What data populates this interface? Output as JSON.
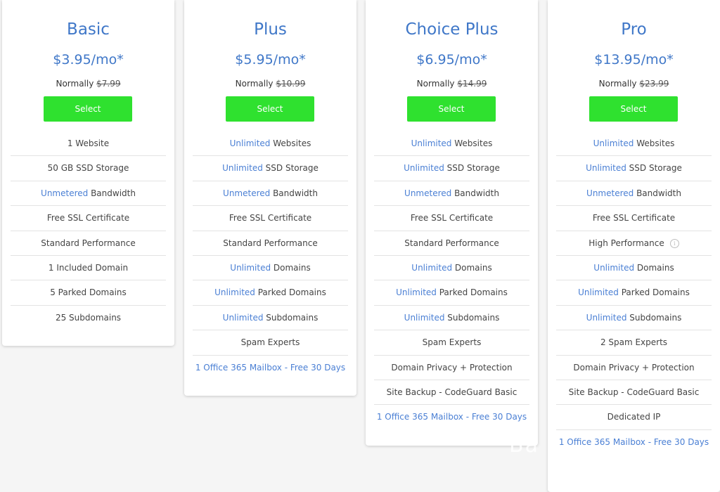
{
  "plans": [
    {
      "title": "Basic",
      "price": "$3.95/mo*",
      "normally_label": "Normally",
      "normally_price": "$7.99",
      "select_label": "Select",
      "features": [
        {
          "highlight": "",
          "text": "1 Website"
        },
        {
          "highlight": "",
          "text": "50 GB SSD Storage"
        },
        {
          "highlight": "Unmetered",
          "text": " Bandwidth"
        },
        {
          "highlight": "",
          "text": "Free SSL Certificate"
        },
        {
          "highlight": "",
          "text": "Standard Performance"
        },
        {
          "highlight": "",
          "text": "1 Included Domain"
        },
        {
          "highlight": "",
          "text": "5 Parked Domains"
        },
        {
          "highlight": "",
          "text": "25 Subdomains"
        }
      ]
    },
    {
      "title": "Plus",
      "price": "$5.95/mo*",
      "normally_label": "Normally",
      "normally_price": "$10.99",
      "select_label": "Select",
      "features": [
        {
          "highlight": "Unlimited",
          "text": " Websites"
        },
        {
          "highlight": "Unlimited",
          "text": " SSD Storage"
        },
        {
          "highlight": "Unmetered",
          "text": " Bandwidth"
        },
        {
          "highlight": "",
          "text": "Free SSL Certificate"
        },
        {
          "highlight": "",
          "text": "Standard Performance"
        },
        {
          "highlight": "Unlimited",
          "text": " Domains"
        },
        {
          "highlight": "Unlimited",
          "text": " Parked Domains"
        },
        {
          "highlight": "Unlimited",
          "text": " Subdomains"
        },
        {
          "highlight": "",
          "text": "Spam Experts"
        },
        {
          "highlight": "1 Office 365 Mailbox - Free 30 Days",
          "text": ""
        }
      ]
    },
    {
      "title": "Choice Plus",
      "price": "$6.95/mo*",
      "normally_label": "Normally",
      "normally_price": "$14.99",
      "select_label": "Select",
      "features": [
        {
          "highlight": "Unlimited",
          "text": " Websites"
        },
        {
          "highlight": "Unlimited",
          "text": " SSD Storage"
        },
        {
          "highlight": "Unmetered",
          "text": " Bandwidth"
        },
        {
          "highlight": "",
          "text": "Free SSL Certificate"
        },
        {
          "highlight": "",
          "text": "Standard Performance"
        },
        {
          "highlight": "Unlimited",
          "text": " Domains"
        },
        {
          "highlight": "Unlimited",
          "text": " Parked Domains"
        },
        {
          "highlight": "Unlimited",
          "text": " Subdomains"
        },
        {
          "highlight": "",
          "text": "Spam Experts"
        },
        {
          "highlight": "",
          "text": "Domain Privacy + Protection"
        },
        {
          "highlight": "",
          "text": "Site Backup - CodeGuard Basic"
        },
        {
          "highlight": "1 Office 365 Mailbox - Free 30 Days",
          "text": ""
        }
      ]
    },
    {
      "title": "Pro",
      "price": "$13.95/mo*",
      "normally_label": "Normally",
      "normally_price": "$23.99",
      "select_label": "Select",
      "features": [
        {
          "highlight": "Unlimited",
          "text": " Websites"
        },
        {
          "highlight": "Unlimited",
          "text": " SSD Storage"
        },
        {
          "highlight": "Unmetered",
          "text": " Bandwidth"
        },
        {
          "highlight": "",
          "text": "Free SSL Certificate"
        },
        {
          "highlight": "",
          "text": "High Performance",
          "info_icon": "info-icon"
        },
        {
          "highlight": "Unlimited",
          "text": " Domains"
        },
        {
          "highlight": "Unlimited",
          "text": " Parked Domains"
        },
        {
          "highlight": "Unlimited",
          "text": " Subdomains"
        },
        {
          "highlight": "",
          "text": "2 Spam Experts"
        },
        {
          "highlight": "",
          "text": "Domain Privacy + Protection"
        },
        {
          "highlight": "",
          "text": "Site Backup - CodeGuard Basic"
        },
        {
          "highlight": "",
          "text": "Dedicated IP"
        },
        {
          "highlight": "1 Office 365 Mailbox - Free 30 Days",
          "text": ""
        }
      ]
    }
  ],
  "watermark": "Ba",
  "colors": {
    "accent_blue": "#3f77c8",
    "select_green": "#2fe12f",
    "background": "#f5f5f5"
  }
}
